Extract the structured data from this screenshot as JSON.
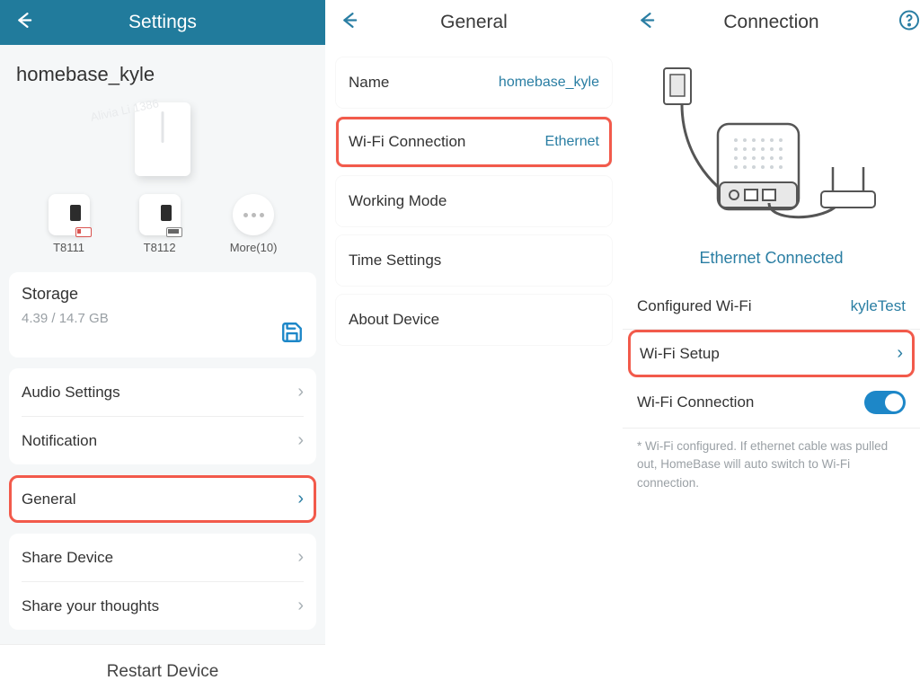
{
  "panel1": {
    "title": "Settings",
    "deviceName": "homebase_kyle",
    "thumbs": [
      {
        "label": "T8111"
      },
      {
        "label": "T8112"
      },
      {
        "label": "More(10)"
      }
    ],
    "storage": {
      "title": "Storage",
      "sub": "4.39 / 14.7 GB"
    },
    "menu": [
      {
        "label": "Audio Settings"
      },
      {
        "label": "Notification"
      },
      {
        "label": "General"
      },
      {
        "label": "Share Device"
      },
      {
        "label": "Share your thoughts"
      }
    ],
    "footer": "Restart Device"
  },
  "panel2": {
    "title": "General",
    "items": [
      {
        "label": "Name",
        "value": "homebase_kyle"
      },
      {
        "label": "Wi-Fi Connection",
        "value": "Ethernet"
      },
      {
        "label": "Working Mode",
        "value": ""
      },
      {
        "label": "Time Settings",
        "value": ""
      },
      {
        "label": "About Device",
        "value": ""
      }
    ]
  },
  "panel3": {
    "title": "Connection",
    "statusLabel": "Ethernet Connected",
    "rows": {
      "configured": {
        "label": "Configured Wi-Fi",
        "value": "kyleTest"
      },
      "setup": {
        "label": "Wi-Fi Setup"
      },
      "toggle": {
        "label": "Wi-Fi Connection"
      }
    },
    "note": "* Wi-Fi configured. If ethernet cable was pulled out, HomeBase will auto switch to Wi-Fi connection."
  },
  "watermark": "Alivia Li 1386"
}
